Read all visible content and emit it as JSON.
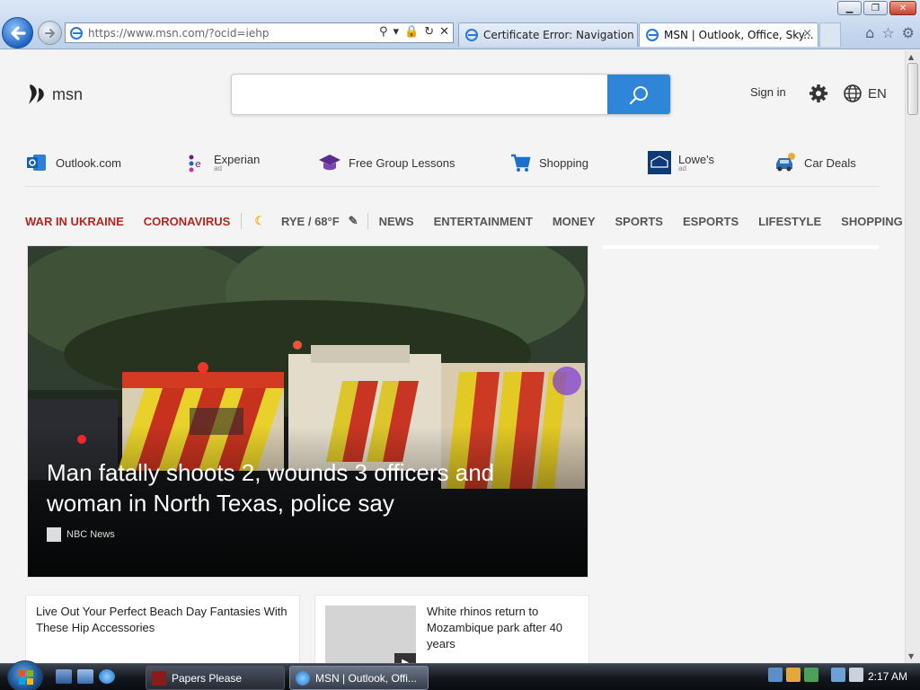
{
  "browser": {
    "address_url": "https://www.msn.com/?ocid=iehp",
    "tabs": [
      {
        "label": "Certificate Error: Navigation Bl...",
        "active": false
      },
      {
        "label": "MSN | Outlook, Office, Sky...",
        "active": true
      }
    ],
    "tab_close_glyph": "×",
    "window_controls": {
      "minimize": "▁",
      "maximize": "❐",
      "close": "✕"
    }
  },
  "msn": {
    "brand": "msn",
    "search": {
      "placeholder": "",
      "value": ""
    },
    "sign_in": "Sign in",
    "language": "EN"
  },
  "quicklinks": [
    {
      "label": "Outlook.com",
      "ad": false,
      "icon": "outlook-icon"
    },
    {
      "label": "Experian",
      "ad": true,
      "ad_label": "ad",
      "icon": "experian-icon"
    },
    {
      "label": "Free Group Lessons",
      "ad": false,
      "icon": "graduation-cap-icon"
    },
    {
      "label": "Shopping",
      "ad": false,
      "icon": "shopping-cart-icon"
    },
    {
      "label": "Lowe's",
      "ad": true,
      "ad_label": "ad",
      "icon": "lowes-icon"
    },
    {
      "label": "Car Deals",
      "ad": false,
      "icon": "car-icon"
    }
  ],
  "topnav": {
    "highlight": [
      "WAR IN UKRAINE",
      "CORONAVIRUS"
    ],
    "weather": "RYE / 68°F",
    "items": [
      "NEWS",
      "ENTERTAINMENT",
      "MONEY",
      "SPORTS",
      "ESPORTS",
      "LIFESTYLE",
      "SHOPPING"
    ]
  },
  "hero": {
    "title": "Man fatally shoots 2, wounds 3 officers and woman in North Texas, police say",
    "source": "NBC News"
  },
  "cards": [
    {
      "title": "Live Out Your Perfect Beach Day Fantasies With These Hip Accessories"
    },
    {
      "title": "White rhinos return to Mozambique park after 40 years"
    }
  ],
  "taskbar": {
    "tasks": [
      {
        "label": "Papers Please"
      },
      {
        "label": "MSN | Outlook, Offi..."
      }
    ],
    "clock": "2:17 AM"
  },
  "colors": {
    "accent_blue": "#2f85d8",
    "highlight_red": "#b3261e"
  }
}
